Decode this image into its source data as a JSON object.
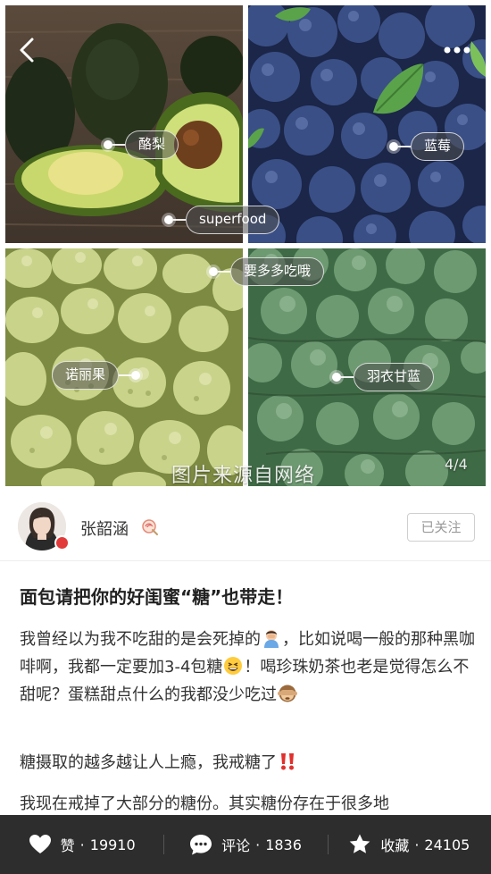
{
  "gallery": {
    "tags": {
      "avocado": "酪梨",
      "blueberry": "蓝莓",
      "superfood": "superfood",
      "eat_more": "要多多吃哦",
      "noni": "诺丽果",
      "kale": "羽衣甘蓝"
    },
    "watermark": "图片来源自网络",
    "page_indicator": "4/4",
    "icons": {
      "back": "back-arrow-icon",
      "more": "more-dots-icon"
    }
  },
  "author": {
    "name": "张韶涵",
    "follow_label": "已关注",
    "verified_color": "#e23a3a"
  },
  "article": {
    "title": "面包请把你的好闺蜜“糖”也带走！",
    "p1_a": "我曾经以为我不吃甜的是会死掉的",
    "p1_b": "，比如说喝一般的那种黑咖啡啊，我都一定要加3-4包糖",
    "p1_c": "！喝珍珠奶茶也老是觉得怎么不甜呢？蛋糕甜点什么的我都没少吃过",
    "p2": "糖摄取的越多越让人上瘾，我戒糖了",
    "p3": "我现在戒掉了大部分的糖份。其实糖份存在于很多地"
  },
  "bottom_bar": {
    "like_label": "赞",
    "like_count": "19910",
    "comment_label": "评论",
    "comment_count": "1836",
    "favorite_label": "收藏",
    "favorite_count": "24105",
    "separator": "·",
    "background": "#2d2d2d"
  }
}
